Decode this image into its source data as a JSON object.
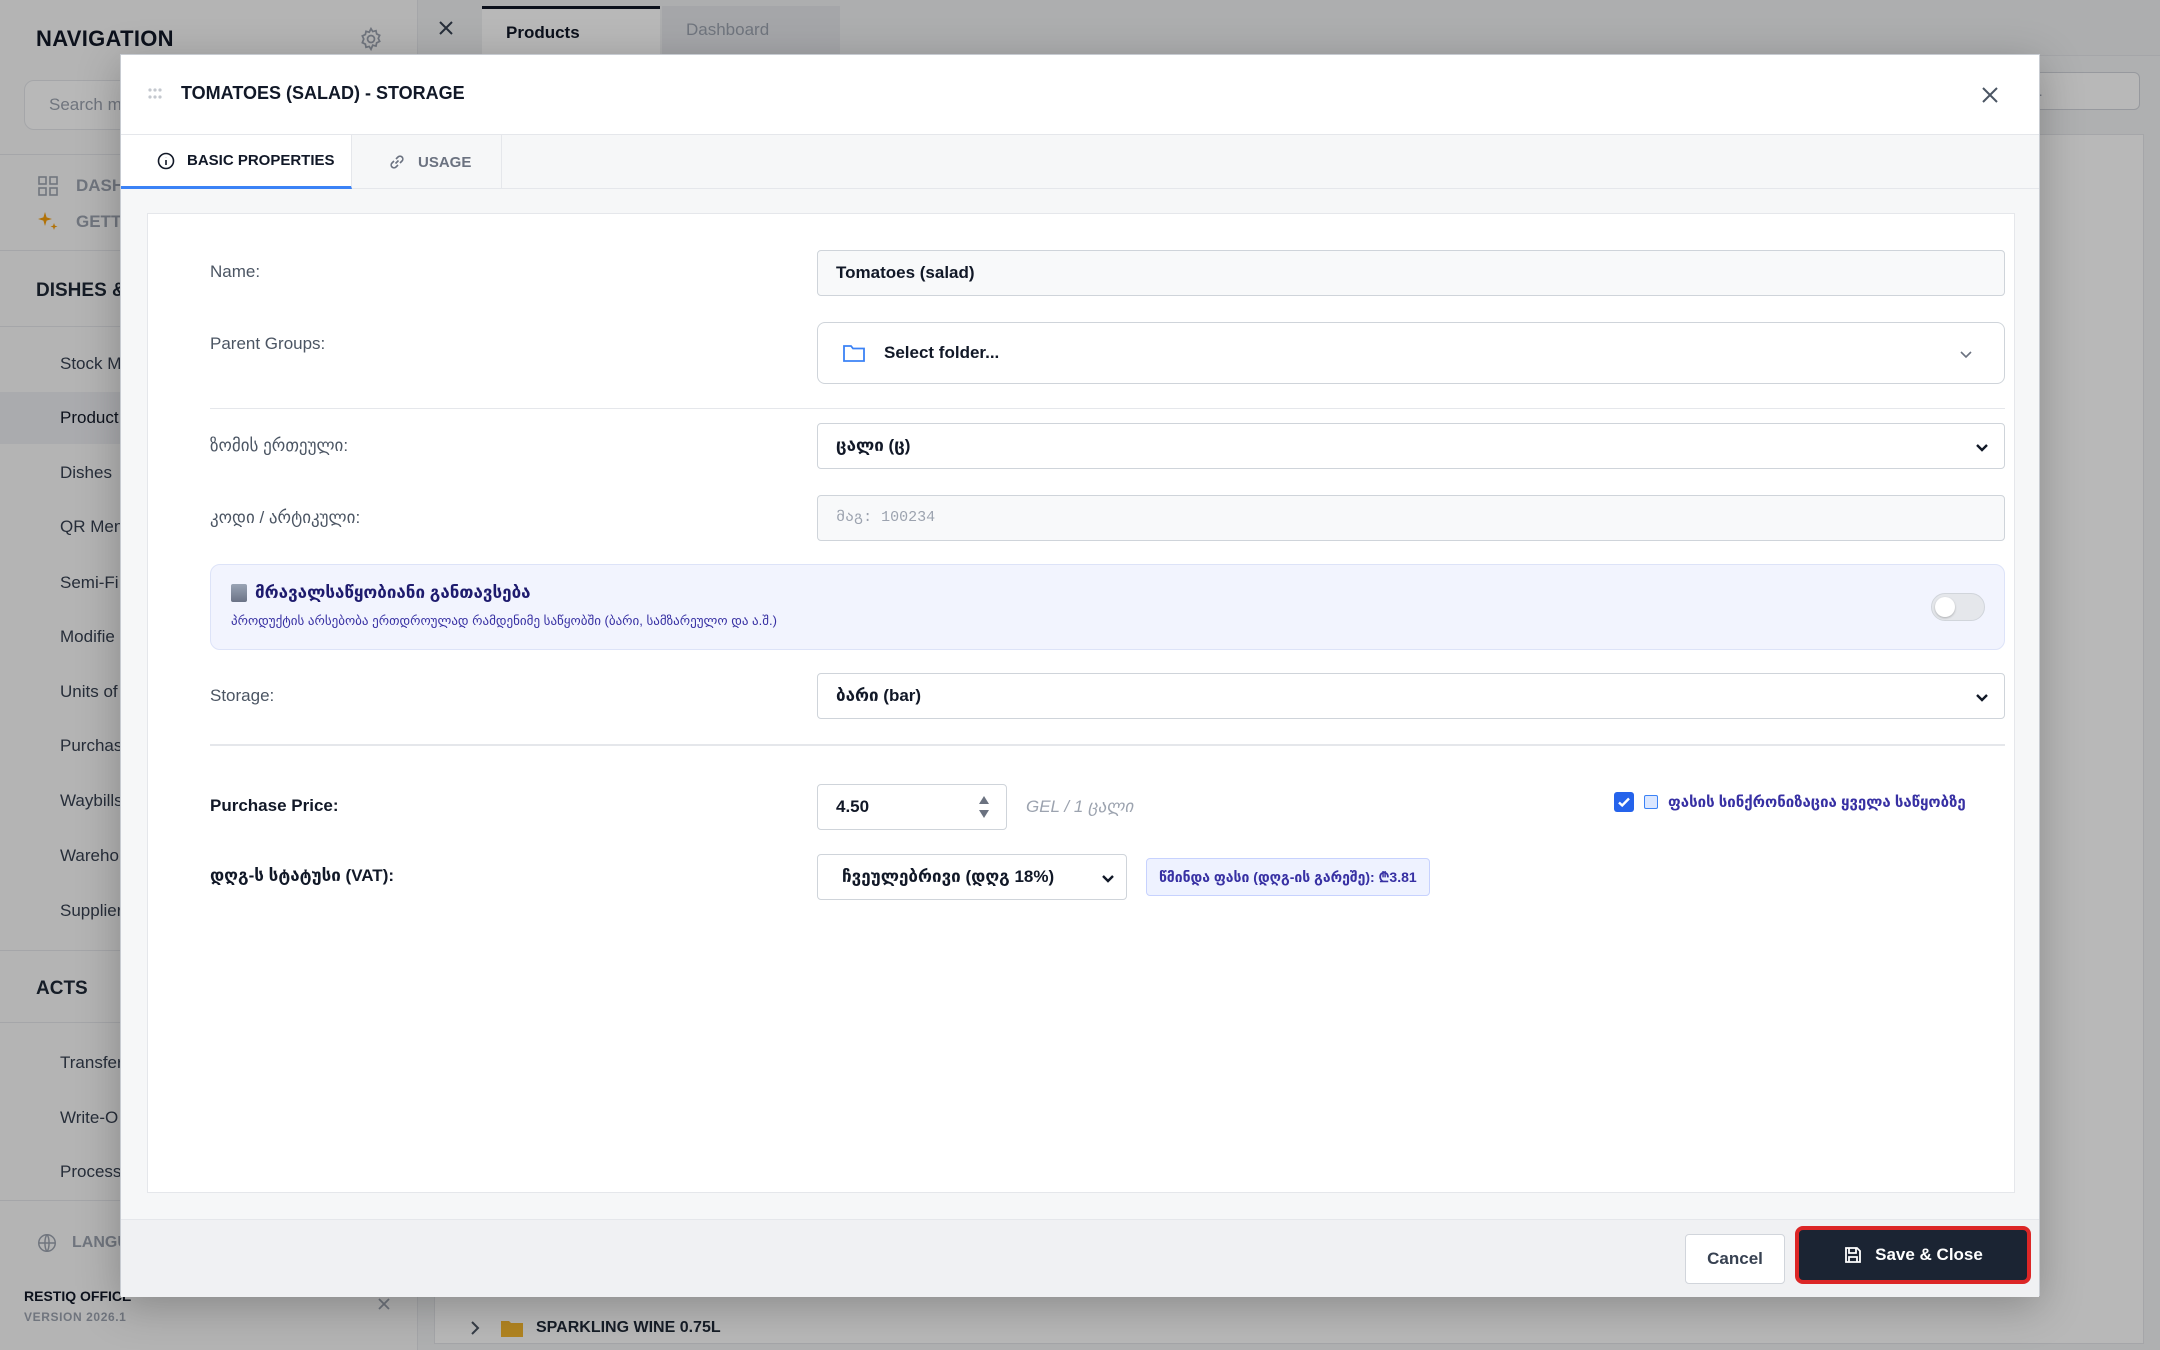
{
  "sidebar": {
    "title": "NAVIGATION",
    "search_placeholder": "Search m",
    "top_items": [
      {
        "label": "DASH",
        "icon": "grid-icon"
      },
      {
        "label": "GETTI",
        "icon": "sparkle-icon"
      }
    ],
    "sections": [
      {
        "title": "DISHES &",
        "items": [
          "Stock M",
          "Product",
          "Dishes",
          "QR Men",
          "Semi-Fi",
          "Modifie",
          "Units of",
          "Purchas",
          "Waybills",
          "Wareho",
          "Supplier"
        ]
      },
      {
        "title": "ACTS",
        "items": [
          "Transfer",
          "Write-O",
          "Processi"
        ]
      }
    ],
    "active_item": "Product",
    "language_label": "LANGU",
    "brand": "RESTIQ OFFICE",
    "version": "VERSION 2026.1"
  },
  "tabs": {
    "items": [
      {
        "label": "Products",
        "active": true
      },
      {
        "label": "Dashboard",
        "active": false
      }
    ]
  },
  "background": {
    "search_placeholder": "...",
    "folder_row_label": "SPARKLING WINE 0.75L"
  },
  "modal": {
    "title": "TOMATOES (SALAD) - STORAGE",
    "tabs": [
      {
        "label": "BASIC PROPERTIES",
        "icon": "info-icon",
        "active": true
      },
      {
        "label": "USAGE",
        "icon": "link-icon",
        "active": false
      }
    ],
    "fields": {
      "name": {
        "label": "Name:",
        "value": "Tomatoes (salad)"
      },
      "parent_groups": {
        "label": "Parent Groups:",
        "value": "Select folder..."
      },
      "unit": {
        "label": "ზომის ერთეული:",
        "value": "ცალი (ც)"
      },
      "code": {
        "label": "კოდი / არტიკული:",
        "placeholder": "მაგ: 100234"
      },
      "storage": {
        "label": "Storage:",
        "value": "ბარი (bar)"
      },
      "purchase_price": {
        "label": "Purchase Price:",
        "value": "4.50",
        "unit": "GEL / 1 ცალი"
      },
      "vat": {
        "label": "დღგ-ს სტატუსი (VAT):",
        "value": "ჩვეულებრივი (დღგ 18%)",
        "net_price": "წმინდა ფასი (დღგ-ის გარეშე): ₾3.81"
      }
    },
    "multi_storage": {
      "title": "მრავალსაწყობიანი განთავსება",
      "description": "პროდუქტის არსებობა ერთდროულად რამდენიმე საწყობში (ბარი, სამზარეულო და ა.შ.)",
      "enabled": false
    },
    "price_sync": {
      "label": "ფასის სინქრონიზაცია ყველა საწყობზე",
      "checked": true
    },
    "footer": {
      "cancel": "Cancel",
      "save": "Save & Close"
    }
  }
}
